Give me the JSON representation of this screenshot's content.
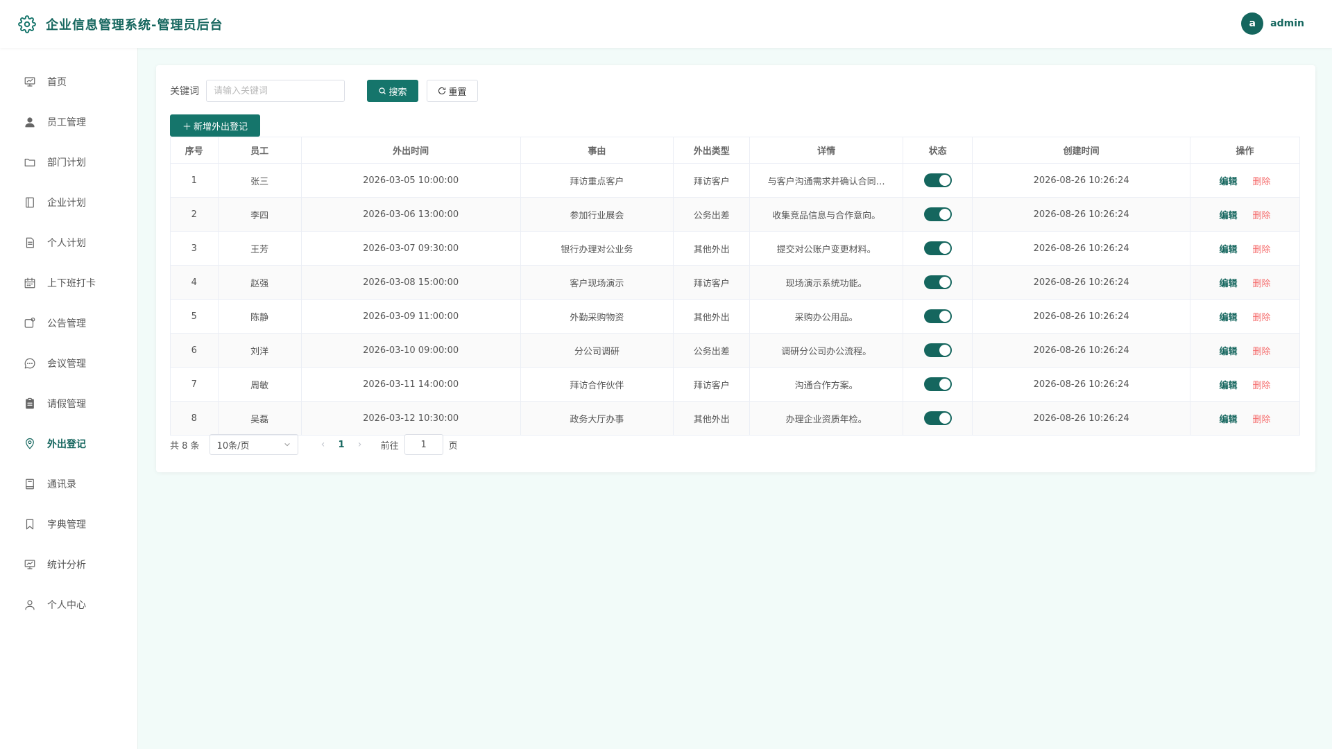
{
  "app": {
    "title": "企业信息管理系统-管理员后台"
  },
  "user": {
    "avatar_letter": "a",
    "name": "admin"
  },
  "sidebar": {
    "items": [
      {
        "label": "首页",
        "icon": "presentation-icon",
        "active": false
      },
      {
        "label": "员工管理",
        "icon": "user-icon",
        "active": false
      },
      {
        "label": "部门计划",
        "icon": "folder-icon",
        "active": false
      },
      {
        "label": "企业计划",
        "icon": "notebook-icon",
        "active": false
      },
      {
        "label": "个人计划",
        "icon": "document-icon",
        "active": false
      },
      {
        "label": "上下班打卡",
        "icon": "calendar-icon",
        "active": false
      },
      {
        "label": "公告管理",
        "icon": "notice-icon",
        "active": false
      },
      {
        "label": "会议管理",
        "icon": "chat-icon",
        "active": false
      },
      {
        "label": "请假管理",
        "icon": "clipboard-icon",
        "active": false
      },
      {
        "label": "外出登记",
        "icon": "location-icon",
        "active": true
      },
      {
        "label": "通讯录",
        "icon": "contacts-icon",
        "active": false
      },
      {
        "label": "字典管理",
        "icon": "bookmark-icon",
        "active": false
      },
      {
        "label": "统计分析",
        "icon": "chart-icon",
        "active": false
      },
      {
        "label": "个人中心",
        "icon": "user-outline-icon",
        "active": false
      }
    ]
  },
  "search": {
    "label": "关键词",
    "placeholder": "请输入关键词",
    "value": "",
    "search_label": "搜索",
    "reset_label": "重置"
  },
  "toolbar": {
    "add_label": "新增外出登记"
  },
  "table": {
    "headers": [
      "序号",
      "员工",
      "外出时间",
      "事由",
      "外出类型",
      "详情",
      "状态",
      "创建时间",
      "操作"
    ],
    "edit_label": "编辑",
    "delete_label": "删除",
    "rows": [
      {
        "index": "1",
        "employee": "张三",
        "out_time": "2026-03-05 10:00:00",
        "reason": "拜访重点客户",
        "type": "拜访客户",
        "detail": "与客户沟通需求并确认合同…",
        "status_on": true,
        "created": "2026-08-26 10:26:24"
      },
      {
        "index": "2",
        "employee": "李四",
        "out_time": "2026-03-06 13:00:00",
        "reason": "参加行业展会",
        "type": "公务出差",
        "detail": "收集竞品信息与合作意向。",
        "status_on": true,
        "created": "2026-08-26 10:26:24"
      },
      {
        "index": "3",
        "employee": "王芳",
        "out_time": "2026-03-07 09:30:00",
        "reason": "银行办理对公业务",
        "type": "其他外出",
        "detail": "提交对公账户变更材料。",
        "status_on": true,
        "created": "2026-08-26 10:26:24"
      },
      {
        "index": "4",
        "employee": "赵强",
        "out_time": "2026-03-08 15:00:00",
        "reason": "客户现场演示",
        "type": "拜访客户",
        "detail": "现场演示系统功能。",
        "status_on": true,
        "created": "2026-08-26 10:26:24"
      },
      {
        "index": "5",
        "employee": "陈静",
        "out_time": "2026-03-09 11:00:00",
        "reason": "外勤采购物资",
        "type": "其他外出",
        "detail": "采购办公用品。",
        "status_on": true,
        "created": "2026-08-26 10:26:24"
      },
      {
        "index": "6",
        "employee": "刘洋",
        "out_time": "2026-03-10 09:00:00",
        "reason": "分公司调研",
        "type": "公务出差",
        "detail": "调研分公司办公流程。",
        "status_on": true,
        "created": "2026-08-26 10:26:24"
      },
      {
        "index": "7",
        "employee": "周敏",
        "out_time": "2026-03-11 14:00:00",
        "reason": "拜访合作伙伴",
        "type": "拜访客户",
        "detail": "沟通合作方案。",
        "status_on": true,
        "created": "2026-08-26 10:26:24"
      },
      {
        "index": "8",
        "employee": "吴磊",
        "out_time": "2026-03-12 10:30:00",
        "reason": "政务大厅办事",
        "type": "其他外出",
        "detail": "办理企业资质年检。",
        "status_on": true,
        "created": "2026-08-26 10:26:24"
      }
    ]
  },
  "pagination": {
    "total_text": "共 8 条",
    "page_size": "10条/页",
    "current_page": "1",
    "goto_label": "前往",
    "goto_value": "1",
    "page_suffix": "页"
  },
  "colors": {
    "brand": "#15665e",
    "danger": "#f56c6c",
    "background": "#f2fbf9"
  }
}
